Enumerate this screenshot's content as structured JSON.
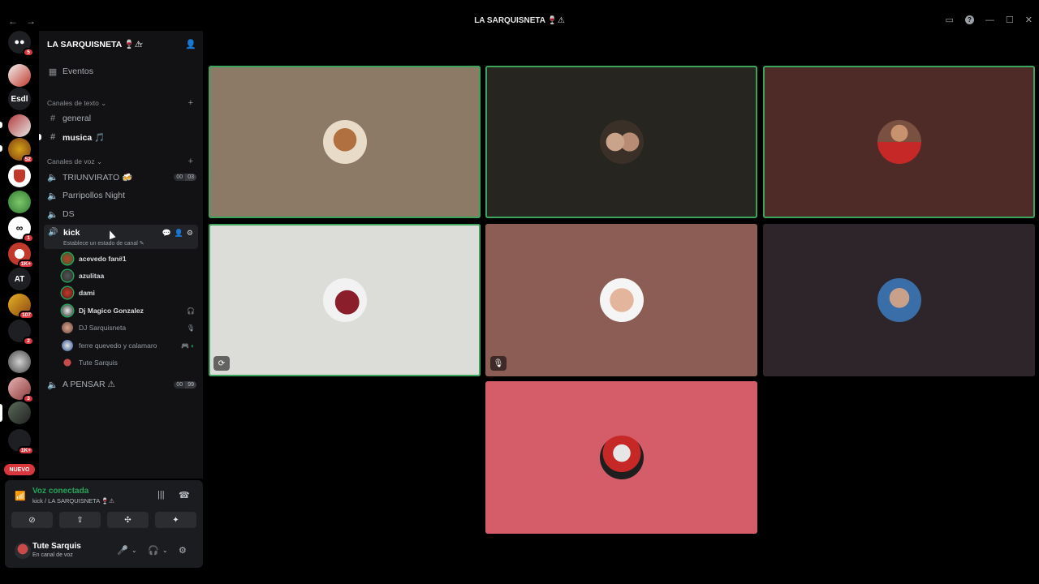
{
  "window": {
    "title": "LA SARQUISNETA 🍷⚠",
    "back": "←",
    "forward": "→",
    "inbox_icon": "▭",
    "help_icon": "?",
    "minimize": "—",
    "maximize": "☐",
    "close": "✕"
  },
  "rail": {
    "dm_badge": "5",
    "servers": [
      {
        "label": "",
        "badge": ""
      },
      {
        "label": "Esdl",
        "badge": ""
      },
      {
        "label": "",
        "badge": ""
      },
      {
        "label": "",
        "badge": "52"
      },
      {
        "label": "",
        "badge": ""
      },
      {
        "label": "",
        "badge": ""
      },
      {
        "label": "",
        "badge": "1"
      },
      {
        "label": "",
        "badge": "1K+"
      },
      {
        "label": "AT",
        "badge": ""
      },
      {
        "label": "",
        "badge": "107"
      },
      {
        "label": "",
        "badge": "2"
      },
      {
        "label": "",
        "badge": ""
      },
      {
        "label": "",
        "badge": "3"
      },
      {
        "label": "",
        "badge": ""
      },
      {
        "label": "",
        "badge": "1K+"
      }
    ],
    "new_label": "NUEVO"
  },
  "sidebar": {
    "guild_name": "LA SARQUISNETA 🍷⚠",
    "events": "Eventos",
    "text_category": "Canales de texto",
    "text_channels": [
      "general",
      "musica 🎵"
    ],
    "voice_category": "Canales de voz",
    "voice_channels": [
      {
        "name": "TRIUNVIRATO 🍻",
        "count_a": "00",
        "count_b": "03"
      },
      {
        "name": "Parripollos Night"
      },
      {
        "name": "DS"
      }
    ],
    "active_channel": {
      "name": "kick",
      "status": "Establece un estado de canal ✎"
    },
    "members": [
      {
        "name": "acevedo fan#1",
        "icons": ""
      },
      {
        "name": "azulitaa",
        "icons": ""
      },
      {
        "name": "dami",
        "icons": ""
      },
      {
        "name": "Dj Magico Gonzalez",
        "icons": "🎧"
      },
      {
        "name": "DJ Sarquisneta",
        "icons": "🎙"
      },
      {
        "name": "ferre quevedo y calamaro",
        "icons": "🎮 ◐"
      },
      {
        "name": "Tute Sarquis",
        "icons": ""
      }
    ],
    "last_channel": {
      "name": "A PENSAR ⚠",
      "count_a": "00",
      "count_b": "99"
    }
  },
  "voice_panel": {
    "status": "Voz conectada",
    "location": "kick / LA SARQUISNETA 🍷⚠"
  },
  "user": {
    "name": "Tute Sarquis",
    "status": "En canal de voz"
  },
  "colors": {
    "tile_1": "#8c7a67",
    "tile_2": "#26251f",
    "tile_3": "#4f2b28",
    "tile_4": "#dcdcd8",
    "tile_5": "#8b5d55",
    "tile_6": "#2d252a",
    "tile_7": "#d45d69",
    "speaking": "#3ba55c"
  }
}
